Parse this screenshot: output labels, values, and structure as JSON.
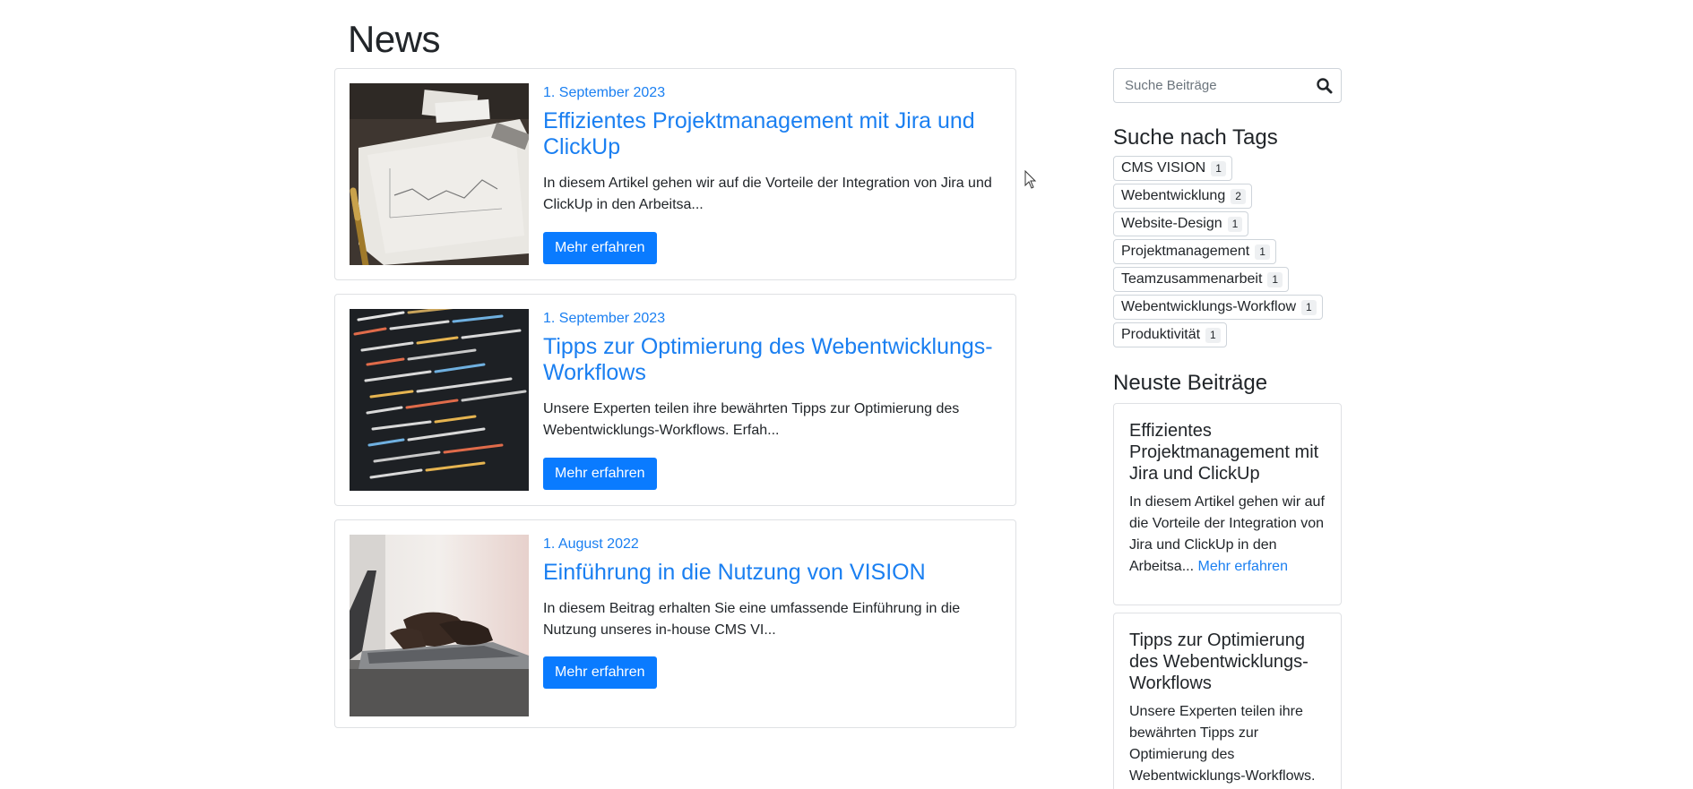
{
  "page": {
    "title": "News"
  },
  "articles": [
    {
      "date": "1. September 2023",
      "title": "Effizientes Projektmanagement mit Jira und ClickUp",
      "excerpt": "In diesem Artikel gehen wir auf die Vorteile der Integration von Jira und ClickUp in den Arbeitsa...",
      "button": "Mehr erfahren",
      "image": "chart-paper-photo"
    },
    {
      "date": "1. September 2023",
      "title": "Tipps zur Optimierung des Webentwicklungs-Workflows",
      "excerpt": "Unsere Experten teilen ihre bewährten Tipps zur Optimierung des Webentwicklungs-Workflows. Erfah...",
      "button": "Mehr erfahren",
      "image": "code-screen-photo"
    },
    {
      "date": "1. August 2022",
      "title": "Einführung in die Nutzung von VISION",
      "excerpt": "In diesem Beitrag erhalten Sie eine umfassende Einführung in die Nutzung unseres in-house CMS VI...",
      "button": "Mehr erfahren",
      "image": "laptop-typing-photo"
    }
  ],
  "sidebar": {
    "search": {
      "placeholder": "Suche Beiträge",
      "icon": "search-icon"
    },
    "tags_heading": "Suche nach Tags",
    "tags": [
      {
        "label": "CMS VISION",
        "count": "1"
      },
      {
        "label": "Webentwicklung",
        "count": "2"
      },
      {
        "label": "Website-Design",
        "count": "1"
      },
      {
        "label": "Projektmanagement",
        "count": "1"
      },
      {
        "label": "Teamzusammenarbeit",
        "count": "1"
      },
      {
        "label": "Webentwicklungs-Workflow",
        "count": "1"
      },
      {
        "label": "Produktivität",
        "count": "1"
      }
    ],
    "recent_heading": "Neuste Beiträge",
    "recent": [
      {
        "title": "Effizientes Projektmanagement mit Jira und ClickUp",
        "text": "In diesem Artikel gehen wir auf die Vorteile der Integration von Jira und ClickUp in den Arbeitsa...",
        "link": "Mehr erfahren"
      },
      {
        "title": "Tipps zur Optimierung des Webentwicklungs-Workflows",
        "text": "Unsere Experten teilen ihre bewährten Tipps zur Optimierung des Webentwicklungs-Workflows.",
        "link": ""
      }
    ]
  },
  "colors": {
    "link": "#1a7ff1",
    "button": "#0a7bff",
    "border": "#dfe1e4"
  }
}
